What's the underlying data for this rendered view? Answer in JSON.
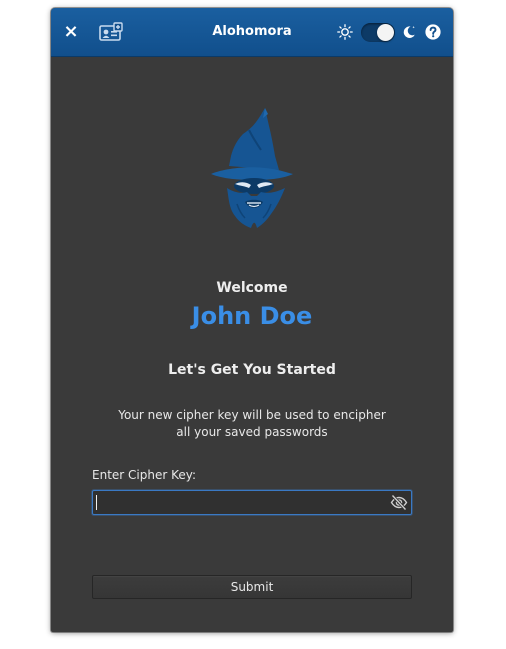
{
  "window": {
    "title": "Alohomora",
    "header_color": "#1a5fa0",
    "background_color": "#3a3a3a"
  },
  "header": {
    "close_label": "×",
    "contact_icon": "contact-card-icon",
    "theme_light_icon": "sun-icon",
    "theme_toggle": {
      "dark_mode": true
    },
    "theme_dark_icon": "moon-icon",
    "help_icon": "help-icon"
  },
  "main": {
    "logo_icon": "wizard-logo",
    "welcome": "Welcome",
    "username": "John Doe",
    "username_color": "#3a8ee6",
    "subtitle": "Let's Get You Started",
    "description_line1": "Your new cipher key will be used to encipher",
    "description_line2": "all your saved passwords",
    "cipher_key_label": "Enter Cipher Key:",
    "cipher_key_value": "",
    "visibility_icon": "eye-slash-icon",
    "submit_label": "Submit"
  }
}
